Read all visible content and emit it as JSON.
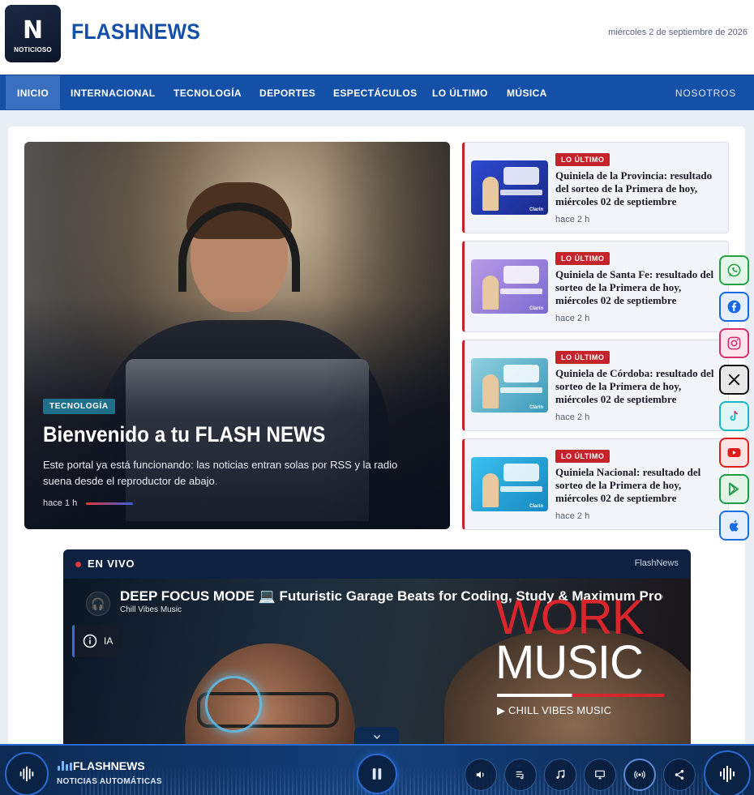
{
  "header": {
    "logo_text": "N",
    "logo_sub": "NOTICIOSO",
    "brand": "FLASHNEWS",
    "date": "miércoles 2 de septiembre de 2026"
  },
  "nav": {
    "items": [
      "INICIO",
      "INTERNACIONAL",
      "TECNOLOGÍA",
      "DEPORTES",
      "ESPECTÁCULOS",
      "LO ÚLTIMO",
      "MÚSICA"
    ],
    "right": "NOSOTROS",
    "active_index": 0
  },
  "hero": {
    "tag": "TECNOLOGÍA",
    "title": "Bienvenido a tu FLASH NEWS",
    "description": "Este portal ya está funcionando: las noticias entran solas por RSS y la radio suena desde el reproductor de abajo.",
    "time": "hace 1 h"
  },
  "side_news": [
    {
      "badge": "LO ÚLTIMO",
      "title": "Quiniela de la Provincia: resultado del sorteo de la Primera de hoy, miércoles 02 de septiembre",
      "time": "hace 2 h",
      "thumb_color": "#1f3fb8",
      "thumb_mark": "Clarín"
    },
    {
      "badge": "LO ÚLTIMO",
      "title": "Quiniela de Santa Fe: resultado del sorteo de la Primera de hoy, miércoles 02 de septiembre",
      "time": "hace 2 h",
      "thumb_color": "#9b82d8",
      "thumb_mark": "Clarín"
    },
    {
      "badge": "LO ÚLTIMO",
      "title": "Quiniela de Córdoba: resultado del sorteo de la Primera de hoy, miércoles 02 de septiembre",
      "time": "hace 2 h",
      "thumb_color": "#4fb0c6",
      "thumb_mark": "Clarín"
    },
    {
      "badge": "LO ÚLTIMO",
      "title": "Quiniela Nacional: resultado del sorteo de la Primera de hoy, miércoles 02 de septiembre",
      "time": "hace 2 h",
      "thumb_color": "#1ea8d8",
      "thumb_mark": "Clarín"
    }
  ],
  "social": [
    {
      "name": "whatsapp-icon",
      "color": "#25a244",
      "bg": "#e4f6ea"
    },
    {
      "name": "facebook-icon",
      "color": "#1668e3",
      "bg": "#e6eefc"
    },
    {
      "name": "instagram-icon",
      "color": "#d62f6c",
      "bg": "#fbe6ee"
    },
    {
      "name": "x-icon",
      "color": "#111111",
      "bg": "#e8e8e8"
    },
    {
      "name": "tiktok-icon",
      "color": "#19b8c8",
      "bg": "#e2f6f8"
    },
    {
      "name": "youtube-icon",
      "color": "#e01d1d",
      "bg": "#fce4e4"
    },
    {
      "name": "google-play-icon",
      "color": "#1e9a4a",
      "bg": "#e2f4e8"
    },
    {
      "name": "apple-icon",
      "color": "#1a6ee0",
      "bg": "#e4eefc"
    }
  ],
  "live": {
    "label": "EN VIVO",
    "source": "FlashNews",
    "video_title": "DEEP FOCUS MODE 💻 Futuristic Garage Beats for Coding, Study & Maximum Produ",
    "channel": "Chill Vibes Music",
    "ia_label": "IA",
    "overlay_work": "WORK",
    "overlay_music": "MUSIC",
    "overlay_brand": "▶ CHILL VIBES MUSIC"
  },
  "player": {
    "station": "FLASHNEWS",
    "subtitle": "NOTICIAS AUTOMÁTICAS",
    "controls": [
      "volume-icon",
      "playlist-icon",
      "music-note-icon",
      "screen-icon",
      "broadcast-icon",
      "share-icon"
    ]
  },
  "colors": {
    "brand_blue": "#1550a8",
    "nav_active": "#3a6fc0",
    "badge_red": "#c4232b",
    "live_bg": "#0e2140",
    "player_bg": "#0c2a52"
  }
}
